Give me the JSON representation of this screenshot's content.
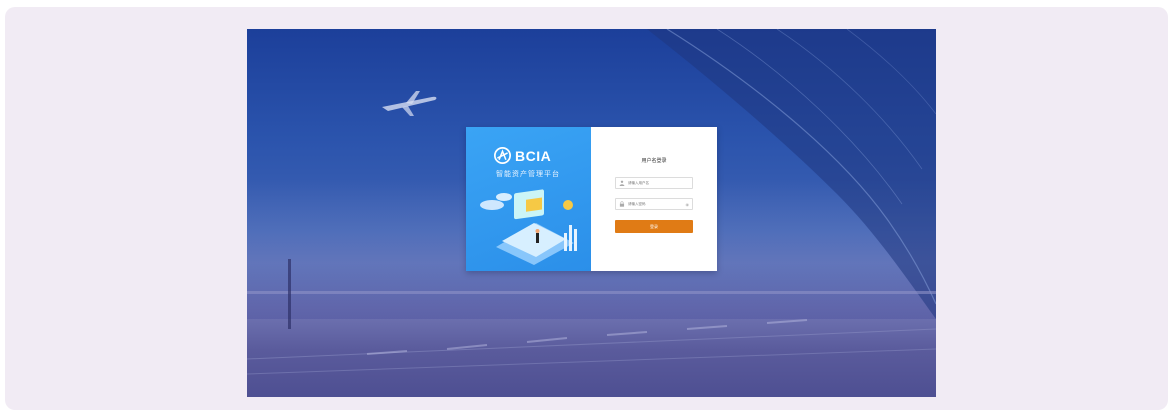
{
  "brand": {
    "name": "BCIA",
    "subtitle": "智能资产管理平台"
  },
  "login": {
    "title": "用户名登录",
    "username_placeholder": "请输入用户名",
    "password_placeholder": "请输入密码",
    "submit_label": "登录"
  },
  "colors": {
    "accent": "#e07b15",
    "panel": "#2b8fe9",
    "background": "#2b54ad"
  },
  "icons": [
    "bcia-logo-icon",
    "user-icon",
    "lock-icon",
    "eye-icon",
    "airplane-icon"
  ]
}
